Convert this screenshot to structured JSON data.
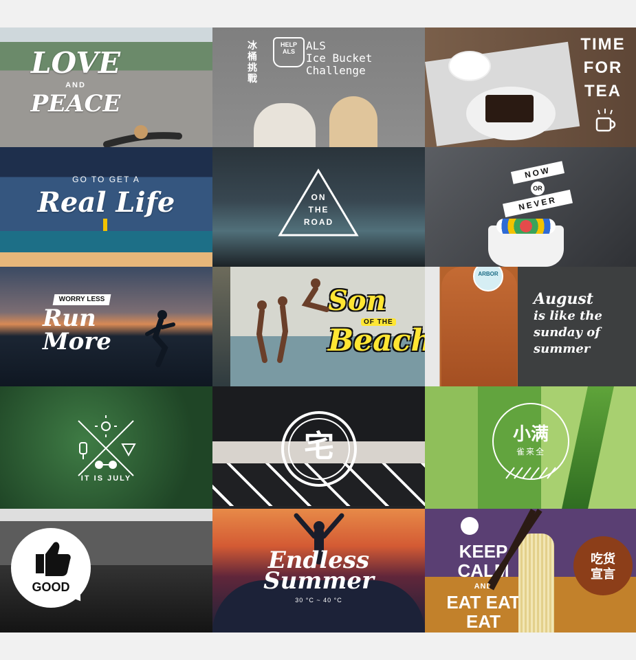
{
  "tiles": [
    {
      "id": "love",
      "text": [
        "LOVE",
        "AND",
        "PEACE"
      ]
    },
    {
      "id": "als",
      "text_cn": [
        "冰",
        "桶",
        "挑",
        "戰"
      ],
      "bucket": [
        "HELP",
        "ALS"
      ],
      "text_en": [
        "ALS",
        "Ice Bucket",
        "Challenge"
      ]
    },
    {
      "id": "tea",
      "text": [
        "TIME",
        "FOR",
        "TEA"
      ],
      "icon": "mug-icon"
    },
    {
      "id": "real",
      "text": [
        "GO TO GET A",
        "Real Life"
      ]
    },
    {
      "id": "road",
      "text": [
        "ON",
        "THE",
        "ROAD"
      ],
      "icon": "triangle-icon"
    },
    {
      "id": "now",
      "text": [
        "NOW",
        "OR",
        "NEVER"
      ]
    },
    {
      "id": "run",
      "text": [
        "WORRY LESS",
        "Run",
        "More"
      ]
    },
    {
      "id": "son",
      "text": [
        "Son",
        "OF THE",
        "Beach"
      ]
    },
    {
      "id": "aug",
      "text": [
        "August",
        "is like the",
        "sunday of",
        "summer"
      ],
      "brand": "ARBOR"
    },
    {
      "id": "july",
      "text": [
        "IT IS JULY"
      ],
      "icons": [
        "sun-icon",
        "ice-cream-icon",
        "watermelon-icon",
        "sunglasses-icon"
      ]
    },
    {
      "id": "zhai",
      "text": [
        "宅"
      ]
    },
    {
      "id": "xiao",
      "text": [
        "小满",
        "雀来全"
      ]
    },
    {
      "id": "good",
      "text": [
        "GOOD"
      ],
      "icon": "thumbs-up-icon"
    },
    {
      "id": "endless",
      "text": [
        "Endless",
        "Summer",
        "30 °C ~ 40 °C"
      ]
    },
    {
      "id": "keep",
      "text": [
        "KEEP",
        "CALM",
        "AND",
        "EAT EAT",
        "EAT"
      ],
      "badge": [
        "吃货",
        "宣言"
      ]
    }
  ],
  "colors": {
    "page_bg": "#f1f1f1",
    "white": "#ffffff",
    "son_yellow": "#ffe633",
    "dark_badge": "#8c3e19",
    "tea_black": "#1b1b1b"
  }
}
